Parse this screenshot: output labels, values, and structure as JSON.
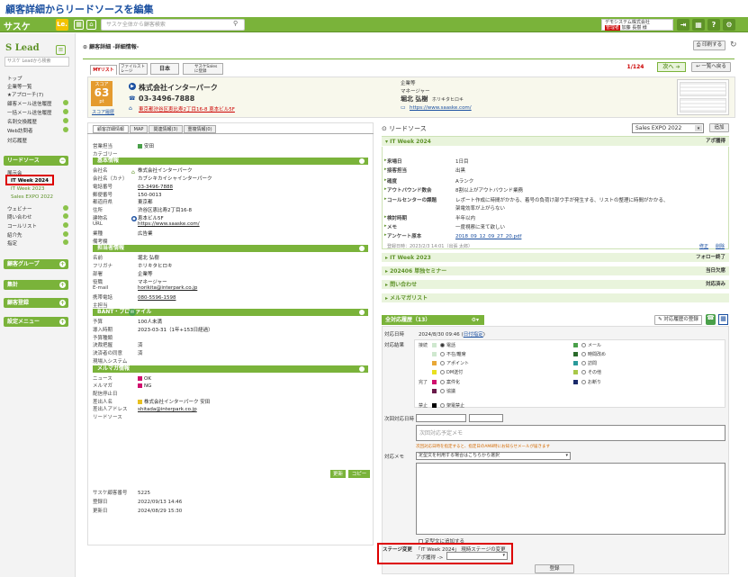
{
  "heading": "顧客詳細からリードソースを編集",
  "app": {
    "logo": "サスケ",
    "le": "Le.",
    "search_placeholder": "サスケ全体から顧客検索",
    "company": "デモシステム株式会社",
    "role": "管理者",
    "user": "加藤 長樹 様"
  },
  "sidebar": {
    "logo": "Lead",
    "search_placeholder": "サスケ Leadから検索",
    "nav": [
      "トップ",
      "企業等一覧",
      "★アプローチ(7)",
      "顧客メール送信履歴",
      "一括メール送信履歴",
      "名刺交換履歴",
      "Web訪問者",
      "対応履歴"
    ],
    "lead_header": "リードソース",
    "lead_items": [
      "展示会",
      "IT Week 2024",
      "IT Week 2023",
      "Sales EXPO 2022",
      "ウェビナー",
      "問い合わせ",
      "コールリスト",
      "紹介先",
      "指定"
    ],
    "groups": [
      "顧客グループ",
      "集計",
      "顧客登録",
      "設定メニュー"
    ]
  },
  "title_bar": {
    "title": "顧客詳細 -詳細情報-",
    "print": "印刷する"
  },
  "tabs": [
    "MYリスト",
    "ファイルストレージ",
    "日本",
    "サスケSales に登録"
  ],
  "pager": {
    "count": "1/124",
    "next": "次へ",
    "back": "一覧へ戻る"
  },
  "card": {
    "score_label": "スコア",
    "score": "63",
    "score_unit": "pt",
    "score_link": "スコア履歴",
    "company": "株式会社インターパーク",
    "phone": "03-3496-7888",
    "address": "東京都渋谷区恵比寿2丁目16-8 恵本ビル5F",
    "person_company": "企業等",
    "person_title": "マネージャー",
    "person_name": "堀北 弘樹",
    "person_kana": "ホリキタヒロキ",
    "url": "https://www.saaske.com/"
  },
  "left_tabs": [
    "顧客詳細情報",
    "MAP",
    "関連情報(3)",
    "重複情報(0)"
  ],
  "top_rows": [
    {
      "l": "営業担当",
      "v": "安田"
    },
    {
      "l": "カテゴリー",
      "v": ""
    }
  ],
  "basic": {
    "h": "基本情報",
    "rows": [
      {
        "l": "会社名",
        "v": "株式会社インターパーク"
      },
      {
        "l": "会社名（カナ）",
        "v": "カブシキカイシャインターパーク"
      },
      {
        "l": "電話番号",
        "v": "03-3496-7888"
      },
      {
        "l": "郵便番号",
        "v": "150-0013"
      },
      {
        "l": "都道府県",
        "v": "東京都"
      },
      {
        "l": "住所",
        "v": "渋谷区恵比寿2丁目16-8"
      },
      {
        "l": "建物名",
        "v": "恵本ビル5F"
      },
      {
        "l": "URL",
        "v": "https://www.saaske.com/"
      },
      {
        "l": "業種",
        "v": "広告業"
      },
      {
        "l": "備考欄",
        "v": ""
      }
    ]
  },
  "person": {
    "h": "担当者情報",
    "rows": [
      {
        "l": "名前",
        "v": "堀北 弘樹"
      },
      {
        "l": "フリガナ",
        "v": "ホリキタヒロキ"
      },
      {
        "l": "部署",
        "v": "企業等"
      },
      {
        "l": "役職",
        "v": "マネージャー"
      },
      {
        "l": "E-mail",
        "v": "horikita@interpark.co.jp"
      },
      {
        "l": "携帯電話",
        "v": "080-5596-1598"
      },
      {
        "l": "主担当",
        "v": ""
      }
    ]
  },
  "bant": {
    "h": "BANT・プロファイル",
    "rows": [
      {
        "l": "予算",
        "v": "100人未満"
      },
      {
        "l": "導入時期",
        "v": "2023-03-31（1年+153日経過）"
      },
      {
        "l": "予算種類",
        "v": ""
      },
      {
        "l": "決裁把握",
        "v": "済"
      },
      {
        "l": "決済者の同意",
        "v": "済"
      },
      {
        "l": "現場入システム",
        "v": ""
      }
    ]
  },
  "mail": {
    "h": "メルマガ情報",
    "rows": [
      {
        "l": "ニュース",
        "v": "OK"
      },
      {
        "l": "メルマガ",
        "v": "NG"
      },
      {
        "l": "配信停止日",
        "v": ""
      },
      {
        "l": "差出人名",
        "v": "株式会社インターパーク 安田"
      },
      {
        "l": "差出人アドレス",
        "v": "shitada@interpark.co.jp"
      },
      {
        "l": "リードソース",
        "v": ""
      }
    ]
  },
  "left_btns": {
    "edit": "更新",
    "copy": "コピー"
  },
  "meta": [
    {
      "l": "サスケ顧客番号",
      "v": "5225"
    },
    {
      "l": "登録日",
      "v": "2022/09/13 14:46"
    },
    {
      "l": "更新日",
      "v": "2024/08/29 15:30"
    }
  ],
  "lead": {
    "title": "リードソース",
    "select": "Sales EXPO 2022",
    "add": "追加",
    "sec_title": "IT Week 2024",
    "sec_status": "アポ獲得",
    "rows": [
      {
        "l": "来場日",
        "v": "1日目"
      },
      {
        "l": "接客担当",
        "v": "出黒"
      },
      {
        "l": "確度",
        "v": "Aランク"
      },
      {
        "l": "アウトバウンド数会",
        "v": "8割以上がアウトバウンド業務"
      },
      {
        "l": "コールセンターの課題",
        "v": "レポート作成に時間がかかる、着号の負荷け部ウ手が発生する、リストの整理に時間がかかる、"
      },
      {
        "l": "",
        "v": "架電効率が上がらない"
      },
      {
        "l": "検討時期",
        "v": "半年以内"
      },
      {
        "l": "メモ",
        "v": "一度視察に来て欲しい"
      },
      {
        "l": "アンケート原本",
        "v": "2018_09_12_09_27_20.pdf"
      }
    ],
    "reg": "登録日時：2023/2/3 14:01（出張 太郎）",
    "edit": "修正",
    "del": "削除",
    "others": [
      {
        "n": "IT Week 2023",
        "s": "フォロー終了"
      },
      {
        "n": "202406 単独セミナー",
        "s": "当日欠席"
      },
      {
        "n": "問い合わせ",
        "s": "対応済み"
      },
      {
        "n": "メルマガリスト",
        "s": ""
      }
    ]
  },
  "history": {
    "title": "全対応履歴（13）",
    "btn": "対応履歴の登録",
    "date_label": "対応日時",
    "date": "2024/8/30 09:46",
    "date_link": "日付指定",
    "result_label": "対応結果",
    "groups": [
      {
        "g": "接続",
        "items": [
          {
            "t": "電話",
            "c": "#cfe8cf",
            "x": 0
          },
          {
            "t": "不在/離席",
            "c": "#cfe8cf",
            "x": 0
          },
          {
            "t": "アポイント",
            "c": "#e8a838",
            "x": 0
          },
          {
            "t": "DM送付",
            "c": "#e8e020",
            "x": 0
          },
          {
            "t": "メール",
            "c": "#4aa04a",
            "x": 1
          },
          {
            "t": "時間改め",
            "c": "#2a6a2a",
            "x": 1
          },
          {
            "t": "訪問",
            "c": "#2a9a9a",
            "x": 1
          },
          {
            "t": "その他",
            "c": "#a8c848",
            "x": 1
          }
        ]
      },
      {
        "g": "完了",
        "items": [
          {
            "t": "案件化",
            "c": "#d0106e",
            "x": 0
          },
          {
            "t": "協議",
            "c": "#6a1a4a",
            "x": 0
          },
          {
            "t": "お断り",
            "c": "#1a2a6a",
            "x": 1
          }
        ]
      },
      {
        "g": "禁止",
        "items": [
          {
            "t": "架電禁止",
            "c": "#000",
            "x": 0
          }
        ]
      }
    ],
    "next_label": "次回対応日時",
    "next_placeholder": "次回対応予定メモ",
    "warn": "次回対応日時を指定すると、指定日のAM8時にお知らせメールが届きます",
    "memo_label": "対応メモ",
    "memo_select": "定型文を利用する場合はこちらから選択",
    "memo_check": "定型文に追加する",
    "stage_label": "ステージ変更",
    "stage_text": "「IT Week 2024」 現時ステージの変更",
    "stage_sub": "アポ獲得 ->",
    "submit": "登録"
  },
  "colors": {
    "accent": "#7ab33a",
    "score": "#e49b2e",
    "link": "#1a4fa0",
    "highlight": "#d00000"
  }
}
